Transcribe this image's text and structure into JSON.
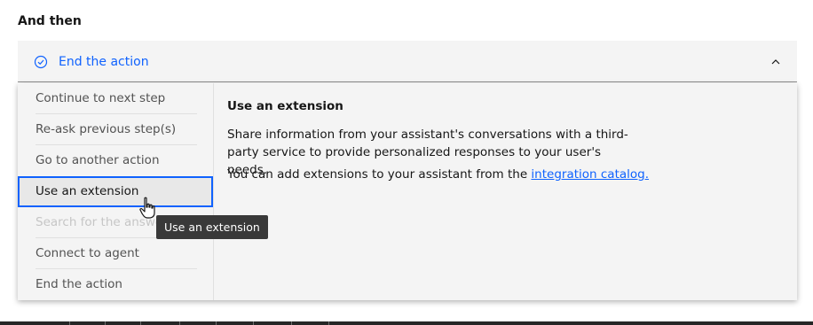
{
  "section": {
    "label": "And then"
  },
  "dropdown": {
    "selected_label": "End the action",
    "accent_color": "#0f62fe"
  },
  "menu": {
    "items": [
      {
        "label": "Continue to next step",
        "state": "normal"
      },
      {
        "label": "Re-ask previous step(s)",
        "state": "normal"
      },
      {
        "label": "Go to another action",
        "state": "normal"
      },
      {
        "label": "Use an extension",
        "state": "selected"
      },
      {
        "label": "Search for the answer",
        "state": "disabled"
      },
      {
        "label": "Connect to agent",
        "state": "normal"
      },
      {
        "label": "End the action",
        "state": "normal"
      }
    ]
  },
  "detail": {
    "title": "Use an extension",
    "description": "Share information from your assistant's conversations with a third-party service to provide personalized responses to your user's needs.",
    "note_prefix": "You can add extensions to your assistant from the ",
    "note_link": "integration catalog."
  },
  "tooltip": {
    "text": "Use an extension"
  },
  "icons": {
    "check": "checkmark-outline-icon",
    "chevron": "chevron-up-icon",
    "cursor": "hand-pointer-icon"
  }
}
